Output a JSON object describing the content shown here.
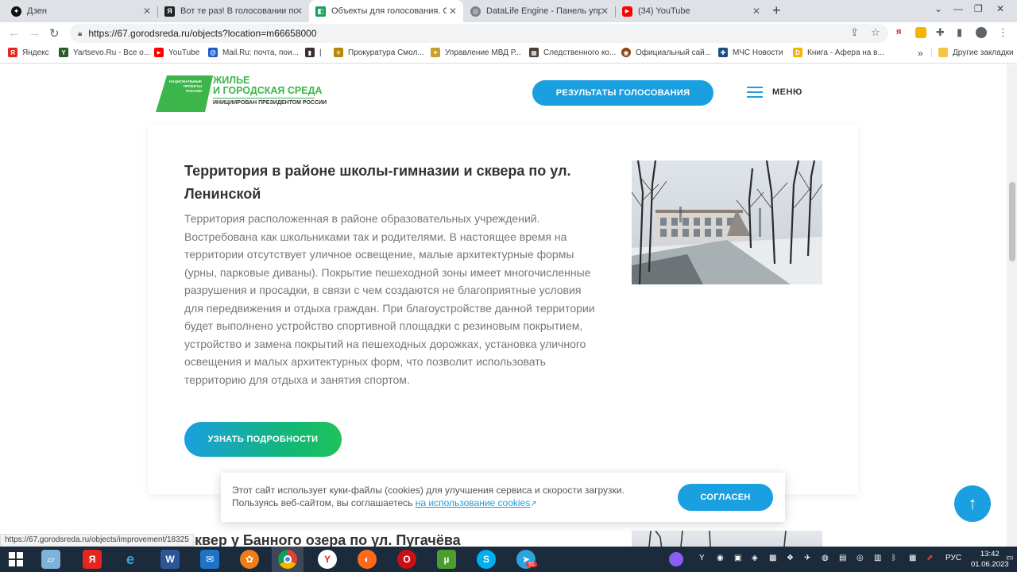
{
  "browser": {
    "tabs": [
      {
        "title": "Дзен",
        "color": "#111111",
        "glyph": "✦"
      },
      {
        "title": "Вот те раз! В голосовании по бл",
        "color": "#222222",
        "glyph": "Я"
      },
      {
        "title": "Объекты для голосования. Смо",
        "color": "#13a05a",
        "glyph": "◧"
      },
      {
        "title": "DataLife Engine - Панель управл",
        "color": "#7a8288",
        "glyph": "◎"
      },
      {
        "title": "(34) YouTube",
        "color": "#ff0000",
        "glyph": "▶"
      }
    ],
    "url": "https://67.gorodsreda.ru/objects?location=m66658000",
    "bookmarks": [
      {
        "label": "Яндекс",
        "color": "#e52620",
        "glyph": "Я"
      },
      {
        "label": "Yartsevo.Ru - Все о...",
        "color": "#2d5b27",
        "glyph": "Y"
      },
      {
        "label": "YouTube",
        "color": "#ff0000",
        "glyph": "▶"
      },
      {
        "label": "Mail.Ru: почта, пои...",
        "color": "#1a5dd1",
        "glyph": "@"
      },
      {
        "label": "|",
        "color": "#3b2f2f",
        "glyph": "▮"
      },
      {
        "label": "Прокуратура Смол...",
        "color": "#b8860b",
        "glyph": "⚜"
      },
      {
        "label": "Управление МВД Р...",
        "color": "#c7a02a",
        "glyph": "✦"
      },
      {
        "label": "Следственного ко...",
        "color": "#4a3f35",
        "glyph": "▦"
      },
      {
        "label": "Официальный сай...",
        "color": "#8b4513",
        "glyph": "◉"
      },
      {
        "label": "МЧС Новости",
        "color": "#1d4e89",
        "glyph": "✚"
      },
      {
        "label": "Книга - Афера на в...",
        "color": "#f4b400",
        "glyph": "D"
      }
    ],
    "bookmarks_more": "»",
    "other_bookmarks": "Другие закладки",
    "status_url": "https://67.gorodsreda.ru/objects/improvement/18325"
  },
  "site": {
    "logo_title_1": "ЖИЛЬЕ",
    "logo_title_2": "И ГОРОДСКАЯ СРЕДА",
    "logo_badge": "НАЦИОНАЛЬНЫЕ ПРОЕКТЫ РОССИИ",
    "logo_sub": "ИНИЦИИРОВАН ПРЕЗИДЕНТОМ РОССИИ",
    "results_button": "РЕЗУЛЬТАТЫ ГОЛОСОВАНИЯ",
    "menu_label": "МЕНЮ"
  },
  "card": {
    "title": "Территория в районе школы-гимназии и сквера по ул. Ленинской",
    "text": "Территория расположенная в районе образовательных учреждений. Востребована как школьниками так и родителями. В настоящее время на территории отсутствует уличное освещение, малые архитектурные формы (урны, парковые диваны). Покрытие пешеходной зоны имеет многочисленные разрушения и просадки, в связи с чем создаются не благоприятные условия для передвижения и отдыха граждан. При благоустройстве данной территории будет выполнено устройство спортивной площадки с резиновым покрытием, устройство и замена покрытий на пешеходных дорожках, установка уличного освещения и малых архитектурных форм, что позволит использовать территорию для отдыха и занятия спортом.",
    "button": "УЗНАТЬ ПОДРОБНОСТИ"
  },
  "next_card": {
    "title": "Сквер у Банного озера по ул. Пугачёва"
  },
  "cookie": {
    "text_1": "Этот сайт использует куки-файлы (cookies) для улучшения сервиса и скорости загрузки.",
    "text_2": "Пользуясь веб-сайтом, вы соглашаетесь",
    "link": "на использование cookies",
    "button": "СОГЛАСЕН"
  },
  "taskbar": {
    "language": "РУС",
    "time": "13:42",
    "date": "01.06.2023",
    "telegram_badge": "91"
  },
  "colors": {
    "accent_blue": "#1a9fe0",
    "brand_green": "#3cb54a",
    "taskbar": "#1c2b3c"
  }
}
